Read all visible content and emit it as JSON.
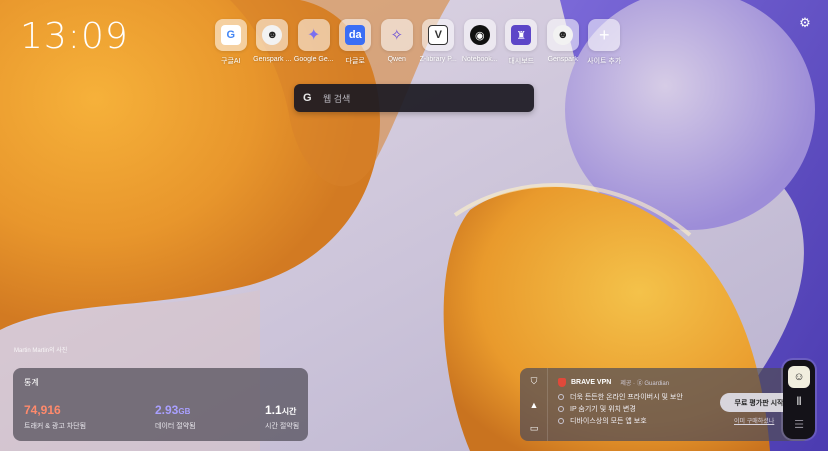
{
  "clock": "13:09",
  "tiles": [
    {
      "label": "구글AI",
      "icon": "google-g-icon",
      "glyph": "G",
      "color": "#4285f4"
    },
    {
      "label": "Genspark ...",
      "icon": "genspark-icon",
      "glyph": "☻",
      "color": "#222222"
    },
    {
      "label": "Google Ge...",
      "icon": "gemini-icon",
      "glyph": "✦",
      "color": "#7a6ff0"
    },
    {
      "label": "다글로",
      "icon": "daglo-icon",
      "glyph": "da",
      "color": "#3b6ef5"
    },
    {
      "label": "Qwen",
      "icon": "qwen-icon",
      "glyph": "✧",
      "color": "#6b4fd6"
    },
    {
      "label": "Z-library P...",
      "icon": "zlibrary-icon",
      "glyph": "V",
      "color": "#333333"
    },
    {
      "label": "Notebook...",
      "icon": "notebooklm-icon",
      "glyph": "◉",
      "color": "#111111"
    },
    {
      "label": "대시보드",
      "icon": "dashboard-icon",
      "glyph": "♜",
      "color": "#5d46c8"
    },
    {
      "label": "Genspark",
      "icon": "genspark-icon",
      "glyph": "☻",
      "color": "#222222"
    },
    {
      "label": "사이트 추가",
      "icon": "plus-icon",
      "glyph": "+",
      "color": "#ffffff"
    }
  ],
  "search": {
    "placeholder": "웹 검색"
  },
  "credit": "Martin Martin의 사진",
  "stats": {
    "title": "통계",
    "trackers": {
      "value": "74,916",
      "label": "트래커 & 광고 차단됨",
      "color": "#ff8a6c"
    },
    "data": {
      "value": "2.93",
      "unit": "GB",
      "label": "데이터 절약됨",
      "color": "#a9a0ff"
    },
    "time": {
      "value": "1.1",
      "unit": "시간",
      "label": "시간 절약됨",
      "color": "#ffffff"
    }
  },
  "vpn": {
    "name": "BRAVE VPN",
    "by": "제공 · ⓖ Guardian",
    "features": [
      "더욱 든든한 온라인 프라이버시 및 보안",
      "IP 숨기기 및 위치 변경",
      "디바이스상의 모든 앱 보호"
    ],
    "cta": "무료 평가판 시작",
    "link": "이미 구매하셨나"
  }
}
